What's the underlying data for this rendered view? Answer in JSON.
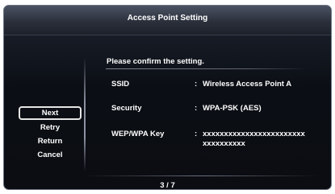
{
  "dialog": {
    "title": "Access Point Setting"
  },
  "menu": {
    "items": [
      {
        "label": "Next"
      },
      {
        "label": "Retry"
      },
      {
        "label": "Return"
      },
      {
        "label": "Cancel"
      }
    ],
    "selected": "Next"
  },
  "content": {
    "prompt": "Please confirm the setting.",
    "rows": [
      {
        "label": "SSID",
        "value": "Wireless Access Point A"
      },
      {
        "label": "Security",
        "value": "WPA-PSK (AES)"
      },
      {
        "label": "WEP/WPA Key",
        "value_line1": "xxxxxxxxxxxxxxxxxxxxxxxx",
        "value_line2": "xxxxxxxxxx"
      }
    ],
    "separator": ":"
  },
  "footer": {
    "page": "3 / 7"
  }
}
